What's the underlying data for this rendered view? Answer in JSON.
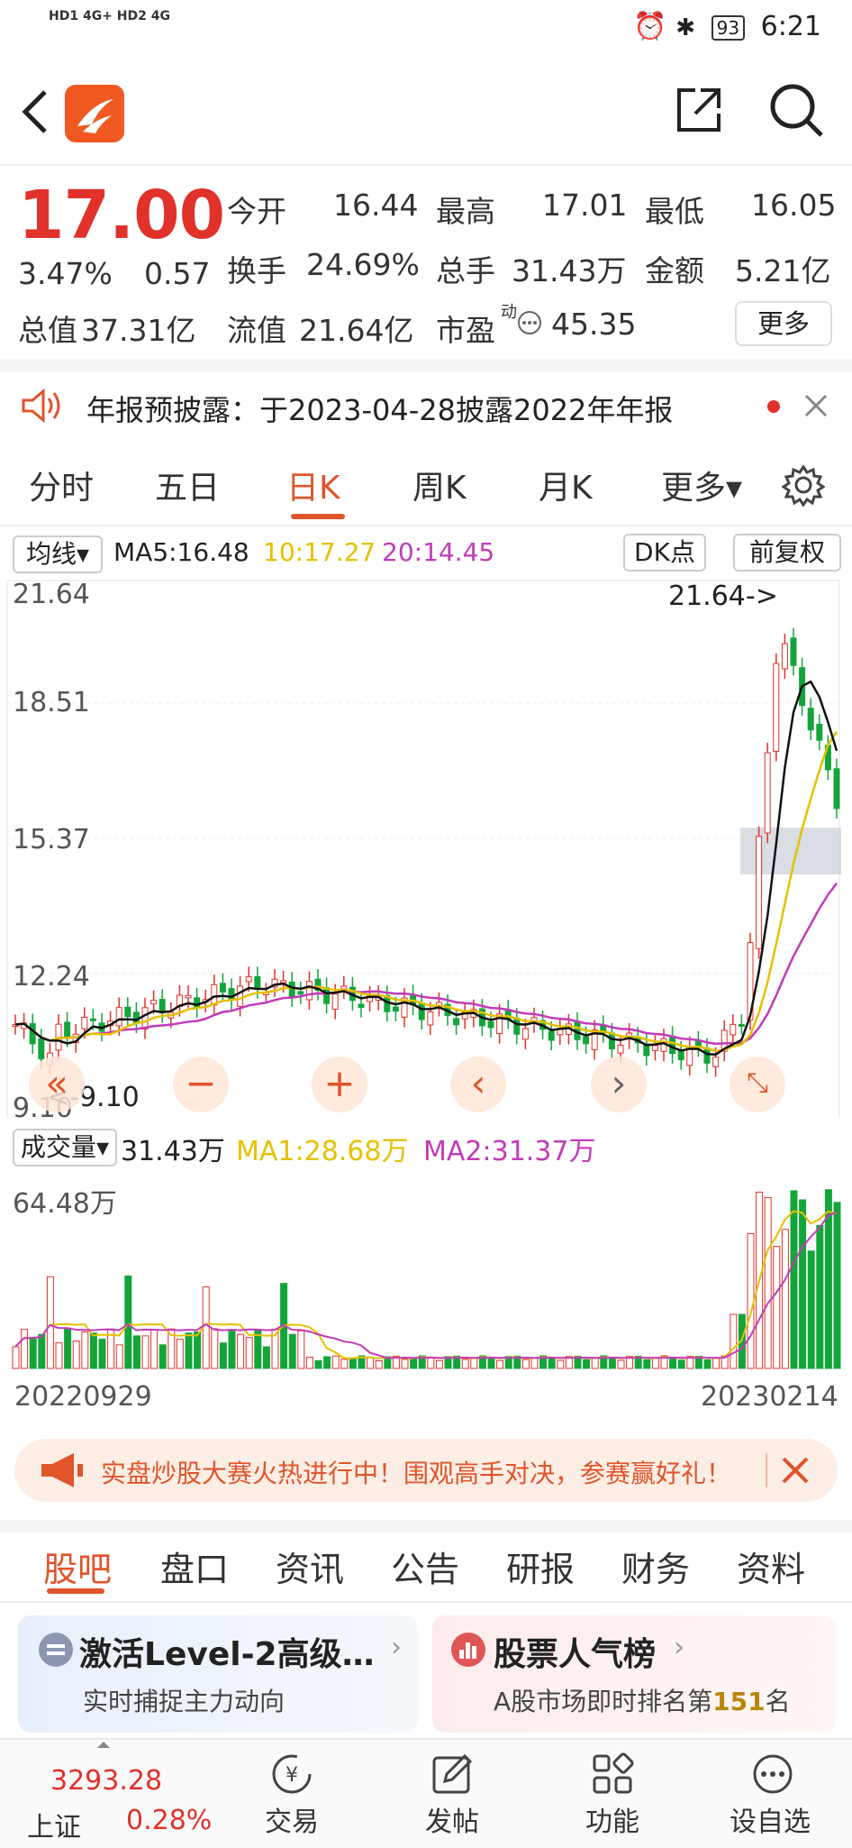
{
  "status_bar": {
    "left_text": "HD1 4G+ HD2 4G",
    "battery": "93",
    "time": "6:21"
  },
  "quote": {
    "price": "17.00",
    "change_pct": "3.47%",
    "change": "0.57",
    "open_label": "今开",
    "open": "16.44",
    "high_label": "最高",
    "high": "17.01",
    "low_label": "最低",
    "low": "16.05",
    "turnover_label": "换手",
    "turnover": "24.69%",
    "volume_label": "总手",
    "volume": "31.43万",
    "amount_label": "金额",
    "amount": "5.21亿",
    "mktcap_label": "总值",
    "mktcap": "37.31亿",
    "float_label": "流值",
    "float": "21.64亿",
    "pe_label": "市盈",
    "pe_sup": "动",
    "pe": "45.35",
    "more": "更多"
  },
  "notice": {
    "text": "年报预披露：于2023-04-28披露2022年年报"
  },
  "chart_tabs": [
    "分时",
    "五日",
    "日K",
    "周K",
    "月K",
    "更多▾"
  ],
  "ma_bar": {
    "selector": "均线▾",
    "ma5": "MA5:16.48",
    "ma10": "10:17.27",
    "ma20": "20:14.45",
    "dk": "DK点",
    "fq": "前复权"
  },
  "price_axis": [
    "21.64",
    "18.51",
    "15.37",
    "12.24",
    "9.10"
  ],
  "max_label": "21.64->",
  "min_label": "<-9.10",
  "volume_bar": {
    "selector": "成交量▾",
    "vol": "31.43万",
    "ma1": "MA1:28.68万",
    "ma2": "MA2:31.37万",
    "axis_max": "64.48万"
  },
  "date_axis": {
    "start": "20220929",
    "end": "20230214"
  },
  "promo": {
    "text": "实盘炒股大赛火热进行中！围观高手对决，参赛赢好礼！"
  },
  "info_tabs": [
    "股吧",
    "盘口",
    "资讯",
    "公告",
    "研报",
    "财务",
    "资料"
  ],
  "cards": [
    {
      "title": "激活Level-2高级…",
      "sub": "实时捕捉主力动向"
    },
    {
      "title": "股票人气榜",
      "sub_prefix": "A股市场即时排名第",
      "sub_rank": "151",
      "sub_suffix": "名"
    }
  ],
  "bottom_nav": {
    "index_value": "3293.28",
    "index_name": "上证",
    "index_change": "0.28%",
    "items": [
      "交易",
      "发帖",
      "功能",
      "设自选"
    ]
  },
  "colors": {
    "up": "#e0312a",
    "down": "#13a53a",
    "accent": "#e0542b",
    "ma5": "#111111",
    "ma10": "#e6c000",
    "ma20": "#c23bb8"
  }
}
